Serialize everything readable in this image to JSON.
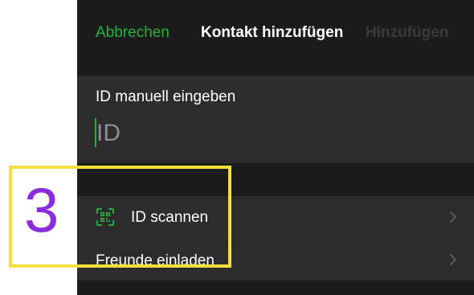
{
  "navbar": {
    "cancel_label": "Abbrechen",
    "title": "Kontakt hinzufügen",
    "add_label": "Hinzufügen"
  },
  "id_entry": {
    "label": "ID manuell eingeben",
    "value": "",
    "placeholder": "ID"
  },
  "actions": {
    "scan_label": "ID scannen",
    "scan_icon": "qr-scan-icon",
    "invite_label": "Freunde einladen",
    "chevron_icon": "chevron-right-icon"
  },
  "annotation": {
    "step_number": "3",
    "highlight_color": "#f5de3a",
    "number_color": "#8a2be2"
  },
  "colors": {
    "accent_green": "#24b33a",
    "background": "#1c1c1e",
    "cell_background": "#2c2c2e",
    "disabled_text": "#3a3a3d"
  }
}
